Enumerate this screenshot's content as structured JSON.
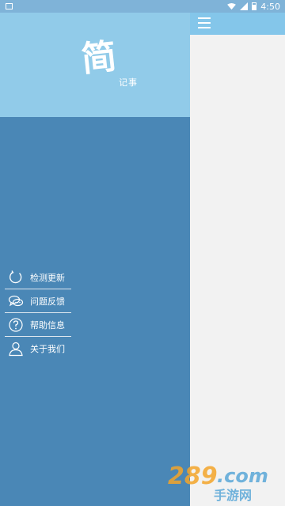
{
  "status_bar": {
    "time": "4:50"
  },
  "drawer": {
    "logo_big": "简",
    "logo_small": "记事",
    "menu": [
      {
        "label": "检测更新",
        "icon": "refresh-icon"
      },
      {
        "label": "问题反馈",
        "icon": "chat-bubbles-icon"
      },
      {
        "label": "帮助信息",
        "icon": "help-icon"
      },
      {
        "label": "关于我们",
        "icon": "user-icon"
      }
    ]
  },
  "toolbar": {
    "menu_icon": "hamburger-icon"
  },
  "watermark": {
    "text": "289.com",
    "sub": "手游网"
  },
  "colors": {
    "drawer_bg": "#4a87b6",
    "drawer_header_bg": "#91cbe9",
    "toolbar_bg": "#84c6ea",
    "content_bg": "#f2f2f2"
  }
}
